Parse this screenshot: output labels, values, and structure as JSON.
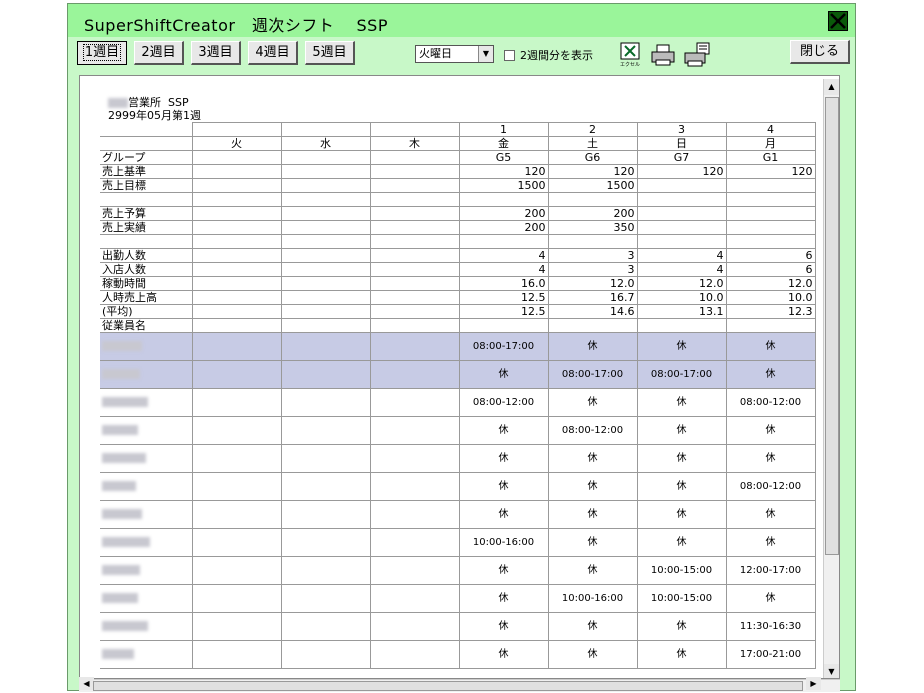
{
  "window": {
    "title": "SuperShiftCreator　週次シフト　 SSP"
  },
  "toolbar": {
    "week_tabs": [
      "1週目",
      "2週目",
      "3週目",
      "4週目",
      "5週目"
    ],
    "selected_tab": 0,
    "day_select_value": "火曜日",
    "two_week_label": "2週間分を表示",
    "excel_label": "エクセル",
    "close_label": "閉じる"
  },
  "report": {
    "office_suffix": "営業所",
    "office_code": "SSP",
    "period": "2999年05月第1週"
  },
  "columns": [
    {
      "date": "",
      "weekday": "火",
      "group": ""
    },
    {
      "date": "",
      "weekday": "水",
      "group": ""
    },
    {
      "date": "",
      "weekday": "木",
      "group": ""
    },
    {
      "date": "1",
      "weekday": "金",
      "group": "G5"
    },
    {
      "date": "2",
      "weekday": "土",
      "group": "G6"
    },
    {
      "date": "3",
      "weekday": "日",
      "group": "G7"
    },
    {
      "date": "4",
      "weekday": "月",
      "group": "G1"
    }
  ],
  "group_label": "グループ",
  "metrics": [
    {
      "label": "売上基準",
      "values": [
        "",
        "",
        "",
        "120",
        "120",
        "120",
        "120"
      ]
    },
    {
      "label": "売上目標",
      "values": [
        "",
        "",
        "",
        "1500",
        "1500",
        "",
        ""
      ]
    },
    {
      "label": "",
      "values": [
        "",
        "",
        "",
        "",
        "",
        "",
        ""
      ]
    },
    {
      "label": "売上予算",
      "values": [
        "",
        "",
        "",
        "200",
        "200",
        "",
        ""
      ]
    },
    {
      "label": "売上実績",
      "values": [
        "",
        "",
        "",
        "200",
        "350",
        "",
        ""
      ]
    },
    {
      "label": "",
      "values": [
        "",
        "",
        "",
        "",
        "",
        "",
        ""
      ]
    },
    {
      "label": "出勤人数",
      "values": [
        "",
        "",
        "",
        "4",
        "3",
        "4",
        "6"
      ]
    },
    {
      "label": "入店人数",
      "values": [
        "",
        "",
        "",
        "4",
        "3",
        "4",
        "6"
      ]
    },
    {
      "label": "稼動時間",
      "values": [
        "",
        "",
        "",
        "16.0",
        "12.0",
        "12.0",
        "12.0"
      ]
    },
    {
      "label": "人時売上高",
      "values": [
        "",
        "",
        "",
        "12.5",
        "16.7",
        "10.0",
        "10.0"
      ]
    },
    {
      "label": "(平均)",
      "values": [
        "",
        "",
        "",
        "12.5",
        "14.6",
        "13.1",
        "12.3"
      ]
    }
  ],
  "employee_label": "従業員名",
  "employees": [
    {
      "highlight": true,
      "shifts": [
        "",
        "",
        "",
        "08:00-17:00",
        "休",
        "休",
        "休"
      ]
    },
    {
      "highlight": true,
      "shifts": [
        "",
        "",
        "",
        "休",
        "08:00-17:00",
        "08:00-17:00",
        "休"
      ]
    },
    {
      "highlight": false,
      "shifts": [
        "",
        "",
        "",
        "08:00-12:00",
        "休",
        "休",
        "08:00-12:00"
      ]
    },
    {
      "highlight": false,
      "shifts": [
        "",
        "",
        "",
        "休",
        "08:00-12:00",
        "休",
        "休"
      ]
    },
    {
      "highlight": false,
      "shifts": [
        "",
        "",
        "",
        "休",
        "休",
        "休",
        "休"
      ]
    },
    {
      "highlight": false,
      "shifts": [
        "",
        "",
        "",
        "休",
        "休",
        "休",
        "08:00-12:00"
      ]
    },
    {
      "highlight": false,
      "shifts": [
        "",
        "",
        "",
        "休",
        "休",
        "休",
        "休"
      ]
    },
    {
      "highlight": false,
      "shifts": [
        "",
        "",
        "",
        "10:00-16:00",
        "休",
        "休",
        "休"
      ]
    },
    {
      "highlight": false,
      "shifts": [
        "",
        "",
        "",
        "休",
        "休",
        "10:00-15:00",
        "12:00-17:00"
      ]
    },
    {
      "highlight": false,
      "shifts": [
        "",
        "",
        "",
        "休",
        "10:00-16:00",
        "10:00-15:00",
        "休"
      ]
    },
    {
      "highlight": false,
      "shifts": [
        "",
        "",
        "",
        "休",
        "休",
        "休",
        "11:30-16:30"
      ]
    },
    {
      "highlight": false,
      "shifts": [
        "",
        "",
        "",
        "休",
        "休",
        "休",
        "17:00-21:00"
      ]
    }
  ],
  "colors": {
    "window_bg": "#c8f8c8",
    "titlebar": "#9af59a",
    "highlight_row": "#c7cbe5"
  }
}
